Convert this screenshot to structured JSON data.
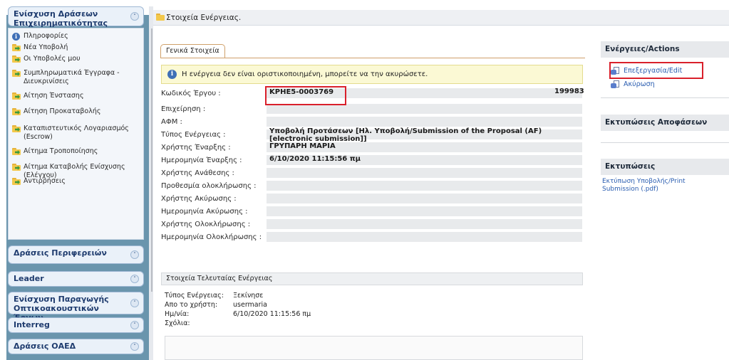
{
  "header": {
    "title": "Στοιχεία Ενέργειας."
  },
  "sidebar": {
    "open_section": {
      "title": "Ενίσχυση Δράσεων Επιχειρηματικότητας"
    },
    "items": [
      {
        "label": "Πληροφορίες",
        "icon": "info-icon"
      },
      {
        "label": "Νέα Υποβολή",
        "icon": "folder-arrow-icon"
      },
      {
        "label": "Οι Υποβολές μου",
        "icon": "folder-arrow-icon"
      },
      {
        "label": "Συμπληρωματικά Έγγραφα - Διευκρινίσεις",
        "icon": "folder-arrow-icon"
      },
      {
        "label": "Αίτηση Ένστασης",
        "icon": "folder-arrow-icon"
      },
      {
        "label": "Αίτηση Προκαταβολής",
        "icon": "folder-arrow-icon"
      },
      {
        "label": "Καταπιστευτικός Λογαριασμός (Escrow)",
        "icon": "folder-arrow-icon"
      },
      {
        "label": "Αίτημα Τροποποίησης",
        "icon": "folder-arrow-icon"
      },
      {
        "label": "Αίτημα Καταβολής Ενίσχυσης (Ελέγχου)",
        "icon": "folder-arrow-icon"
      },
      {
        "label": "Αντιρρήσεις",
        "icon": "folder-arrow-icon"
      }
    ],
    "collapsed_sections": [
      {
        "title": "Δράσεις Περιφερειών"
      },
      {
        "title": "Leader"
      },
      {
        "title": "Ενίσχυση Παραγωγής Οπτικοακουστικών Έργων"
      },
      {
        "title": "Interreg"
      },
      {
        "title": "Δράσεις ΟΑΕΔ"
      }
    ]
  },
  "main": {
    "tab_label": "Γενικά Στοιχεία",
    "notice": "Η ενέργεια δεν είναι οριστικοποιημένη, μπορείτε να την ακυρώσετε.",
    "fields": [
      {
        "label": "Κωδικός Έργου :",
        "value": "ΚΡΗΕ5-0003769"
      },
      {
        "label": "Επιχείρηση :",
        "value": ""
      },
      {
        "label": "ΑΦΜ :",
        "value": ""
      },
      {
        "label": "Τύπος Ενέργειας :",
        "value": "Υποβολή Προτάσεων [Ηλ. Υποβολή/Submission of the Proposal (AF) [electronic submission]]"
      },
      {
        "label": "Χρήστης Έναρξης :",
        "value": "ΓΡΥΠΑΡΗ ΜΑΡΙΑ"
      },
      {
        "label": "Ημερομηνία Έναρξης :",
        "value": "6/10/2020 11:15:56 πμ"
      },
      {
        "label": "Χρήστης Ανάθεσης :",
        "value": ""
      },
      {
        "label": "Προθεσμία ολοκλήρωσης :",
        "value": ""
      },
      {
        "label": "Χρήστης Ακύρωσης :",
        "value": ""
      },
      {
        "label": "Ημερομηνία Ακύρωσης :",
        "value": ""
      },
      {
        "label": "Χρήστης Ολοκλήρωσης :",
        "value": ""
      },
      {
        "label": "Ημερομηνία Ολοκλήρωσης :",
        "value": ""
      }
    ],
    "code_number": "199983",
    "last_action": {
      "header": "Στοιχεία Τελευταίας Ενέργειας",
      "rows": [
        {
          "label": "Τύπος Ενέργειας:",
          "value": "Ξεκίνησε"
        },
        {
          "label": "Απο το χρήστη:",
          "value": "usermaria"
        },
        {
          "label": "Ημ/νία:",
          "value": "6/10/2020 11:15:56 πμ"
        },
        {
          "label": "Σχόλια:",
          "value": ""
        }
      ]
    }
  },
  "right_panel": {
    "actions_title": "Ενέργειες/Actions",
    "actions": [
      {
        "label": "Επεξεργασία/Edit"
      },
      {
        "label": "Ακύρωση"
      }
    ],
    "decisions_title": "Εκτυπώσεις Αποφάσεων",
    "prints_title": "Εκτυπώσεις",
    "print_link": "Εκτύπωση Υποβολής/Print Submission (.pdf)"
  },
  "colors": {
    "sidebar_bg": "#6a95ad",
    "highlight": "#d9202b",
    "link": "#2a5db0",
    "notice_bg": "#fbf9d4"
  }
}
